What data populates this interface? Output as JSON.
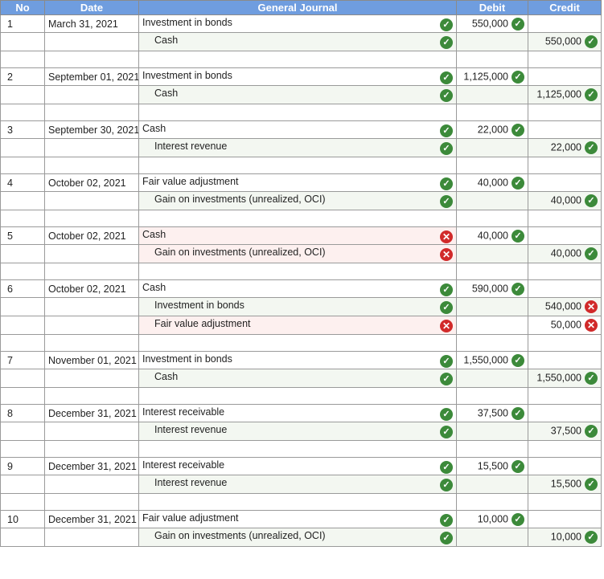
{
  "headers": {
    "no": "No",
    "date": "Date",
    "journal": "General Journal",
    "debit": "Debit",
    "credit": "Credit"
  },
  "entries": [
    {
      "no": "1",
      "date": "March 31, 2021",
      "lines": [
        {
          "account": "Investment in bonds",
          "indent": false,
          "acct_ok": true,
          "debit": "550,000",
          "debit_ok": true,
          "credit": "",
          "credit_ok": null
        },
        {
          "account": "Cash",
          "indent": true,
          "acct_ok": true,
          "debit": "",
          "debit_ok": null,
          "credit": "550,000",
          "credit_ok": true
        }
      ]
    },
    {
      "no": "2",
      "date": "September 01, 2021",
      "lines": [
        {
          "account": "Investment in bonds",
          "indent": false,
          "acct_ok": true,
          "debit": "1,125,000",
          "debit_ok": true,
          "credit": "",
          "credit_ok": null
        },
        {
          "account": "Cash",
          "indent": true,
          "acct_ok": true,
          "debit": "",
          "debit_ok": null,
          "credit": "1,125,000",
          "credit_ok": true
        }
      ]
    },
    {
      "no": "3",
      "date": "September 30, 2021",
      "lines": [
        {
          "account": "Cash",
          "indent": false,
          "acct_ok": true,
          "debit": "22,000",
          "debit_ok": true,
          "credit": "",
          "credit_ok": null
        },
        {
          "account": "Interest revenue",
          "indent": true,
          "acct_ok": true,
          "debit": "",
          "debit_ok": null,
          "credit": "22,000",
          "credit_ok": true
        }
      ]
    },
    {
      "no": "4",
      "date": "October 02, 2021",
      "lines": [
        {
          "account": "Fair value adjustment",
          "indent": false,
          "acct_ok": true,
          "debit": "40,000",
          "debit_ok": true,
          "credit": "",
          "credit_ok": null
        },
        {
          "account": "Gain on investments (unrealized, OCI)",
          "indent": true,
          "acct_ok": true,
          "debit": "",
          "debit_ok": null,
          "credit": "40,000",
          "credit_ok": true
        }
      ]
    },
    {
      "no": "5",
      "date": "October 02, 2021",
      "lines": [
        {
          "account": "Cash",
          "indent": false,
          "acct_ok": false,
          "debit": "40,000",
          "debit_ok": true,
          "credit": "",
          "credit_ok": null
        },
        {
          "account": "Gain on investments (unrealized, OCI)",
          "indent": true,
          "acct_ok": false,
          "debit": "",
          "debit_ok": null,
          "credit": "40,000",
          "credit_ok": true
        }
      ]
    },
    {
      "no": "6",
      "date": "October 02, 2021",
      "lines": [
        {
          "account": "Cash",
          "indent": false,
          "acct_ok": true,
          "debit": "590,000",
          "debit_ok": true,
          "credit": "",
          "credit_ok": null
        },
        {
          "account": "Investment in bonds",
          "indent": true,
          "acct_ok": true,
          "debit": "",
          "debit_ok": null,
          "credit": "540,000",
          "credit_ok": false
        },
        {
          "account": "Fair value adjustment",
          "indent": true,
          "acct_ok": false,
          "debit": "",
          "debit_ok": null,
          "credit": "50,000",
          "credit_ok": false
        }
      ]
    },
    {
      "no": "7",
      "date": "November 01, 2021",
      "lines": [
        {
          "account": "Investment in bonds",
          "indent": false,
          "acct_ok": true,
          "debit": "1,550,000",
          "debit_ok": true,
          "credit": "",
          "credit_ok": null
        },
        {
          "account": "Cash",
          "indent": true,
          "acct_ok": true,
          "debit": "",
          "debit_ok": null,
          "credit": "1,550,000",
          "credit_ok": true
        }
      ]
    },
    {
      "no": "8",
      "date": "December 31, 2021",
      "lines": [
        {
          "account": "Interest receivable",
          "indent": false,
          "acct_ok": true,
          "debit": "37,500",
          "debit_ok": true,
          "credit": "",
          "credit_ok": null
        },
        {
          "account": "Interest revenue",
          "indent": true,
          "acct_ok": true,
          "debit": "",
          "debit_ok": null,
          "credit": "37,500",
          "credit_ok": true
        }
      ]
    },
    {
      "no": "9",
      "date": "December 31, 2021",
      "lines": [
        {
          "account": "Interest receivable",
          "indent": false,
          "acct_ok": true,
          "debit": "15,500",
          "debit_ok": true,
          "credit": "",
          "credit_ok": null
        },
        {
          "account": "Interest revenue",
          "indent": true,
          "acct_ok": true,
          "debit": "",
          "debit_ok": null,
          "credit": "15,500",
          "credit_ok": true
        }
      ]
    },
    {
      "no": "10",
      "date": "December 31, 2021",
      "lines": [
        {
          "account": "Fair value adjustment",
          "indent": false,
          "acct_ok": true,
          "debit": "10,000",
          "debit_ok": true,
          "credit": "",
          "credit_ok": null
        },
        {
          "account": "Gain on investments (unrealized, OCI)",
          "indent": true,
          "acct_ok": true,
          "debit": "",
          "debit_ok": null,
          "credit": "10,000",
          "credit_ok": true
        }
      ]
    }
  ],
  "colors": {
    "header": "#6f9ddf",
    "correct": "#3c8a3a",
    "incorrect": "#d12a2a"
  },
  "icons": {
    "correct": "check-circle-icon",
    "incorrect": "x-circle-icon"
  }
}
